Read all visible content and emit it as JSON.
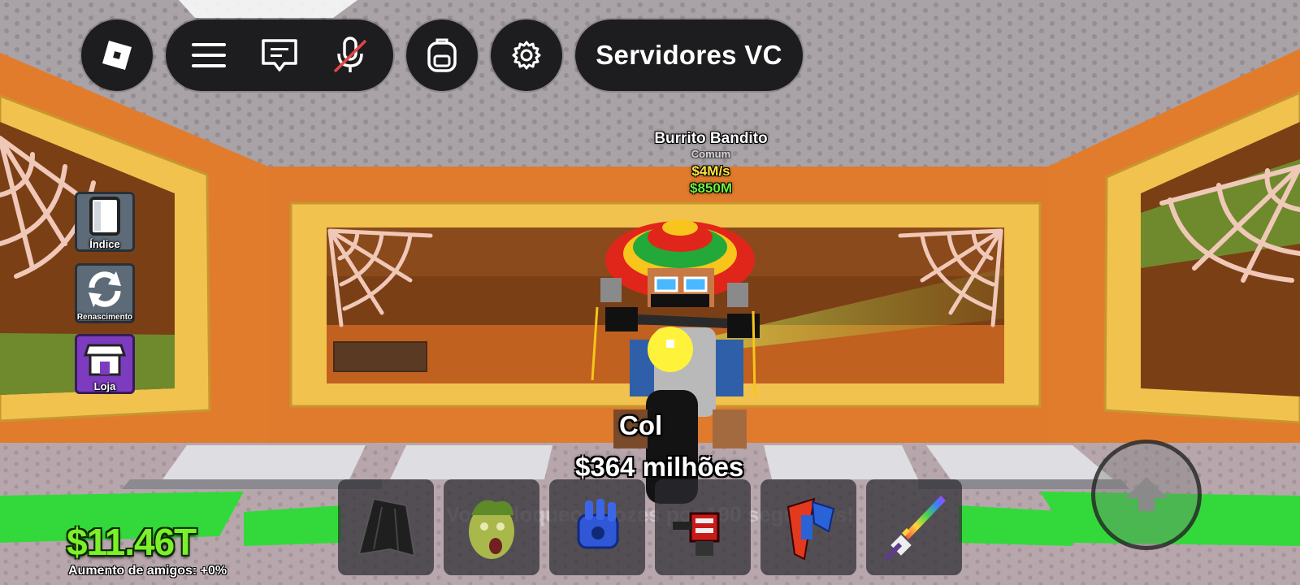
{
  "topbar": {
    "voice_servers_label": "Servidores VC"
  },
  "side_menu": [
    {
      "label": "Índice",
      "icon": "book-icon"
    },
    {
      "label": "Renascimento",
      "icon": "rebirth-icon"
    },
    {
      "label": "Loja",
      "icon": "shop-icon"
    }
  ],
  "nameplate": {
    "name": "Burrito Bandito",
    "subtitle": "Comum",
    "rate": "$4M/s",
    "price": "$850M"
  },
  "collect": {
    "label": "Col",
    "amount": "$364 milhões"
  },
  "hud": {
    "money": "$11.46T",
    "friends_boost": "Aumento de amigos: +0%",
    "notice": "Você bloqueou vozes por 190 segundos!"
  },
  "hotbar": [
    {
      "icon": "black-cape-icon"
    },
    {
      "icon": "medusa-head-icon"
    },
    {
      "icon": "blue-glove-icon"
    },
    {
      "icon": "red-turret-icon"
    },
    {
      "icon": "flag-tool-icon"
    },
    {
      "icon": "rainbow-sword-icon"
    }
  ],
  "colors": {
    "money_green": "#7cf02b",
    "wall_orange": "#e07a2c",
    "frame_yellow": "#f1c34e",
    "ui_dark": "#1d1d1f"
  }
}
